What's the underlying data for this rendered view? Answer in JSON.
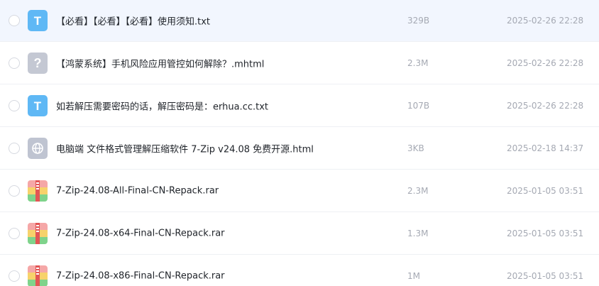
{
  "files": [
    {
      "name": "【必看】【必看】【必看】使用须知.txt",
      "size": "329B",
      "date": "2025-02-26 22:28",
      "icon": "txt-file-icon",
      "icon_glyph": "T",
      "selected": true
    },
    {
      "name": "【鸿蒙系统】手机风险应用管控如何解除？.mhtml",
      "size": "2.3M",
      "date": "2025-02-26 22:28",
      "icon": "unknown-file-icon",
      "icon_glyph": "?",
      "selected": false
    },
    {
      "name": "如若解压需要密码的话，解压密码是：erhua.cc.txt",
      "size": "107B",
      "date": "2025-02-26 22:28",
      "icon": "txt-file-icon",
      "icon_glyph": "T",
      "selected": false
    },
    {
      "name": "电脑端 文件格式管理解压缩软件 7-Zip v24.08 免费开源.html",
      "size": "3KB",
      "date": "2025-02-18 14:37",
      "icon": "globe-file-icon",
      "selected": false
    },
    {
      "name": "7-Zip-24.08-All-Final-CN-Repack.rar",
      "size": "2.3M",
      "date": "2025-01-05 03:51",
      "icon": "archive-file-icon",
      "selected": false
    },
    {
      "name": "7-Zip-24.08-x64-Final-CN-Repack.rar",
      "size": "1.3M",
      "date": "2025-01-05 03:51",
      "icon": "archive-file-icon",
      "selected": false
    },
    {
      "name": "7-Zip-24.08-x86-Final-CN-Repack.rar",
      "size": "1M",
      "date": "2025-01-05 03:51",
      "icon": "archive-file-icon",
      "selected": false
    }
  ],
  "colors": {
    "selected_row": "#f2f6fe",
    "txt_icon": "#5fb8f5",
    "unknown_icon": "#c4c8d3",
    "html_icon": "#bfc4d1",
    "rar_top": "#f5a7a7",
    "rar_mid": "#f7d26b",
    "rar_bottom": "#7fd38b",
    "rar_zipper": "#e25555"
  }
}
